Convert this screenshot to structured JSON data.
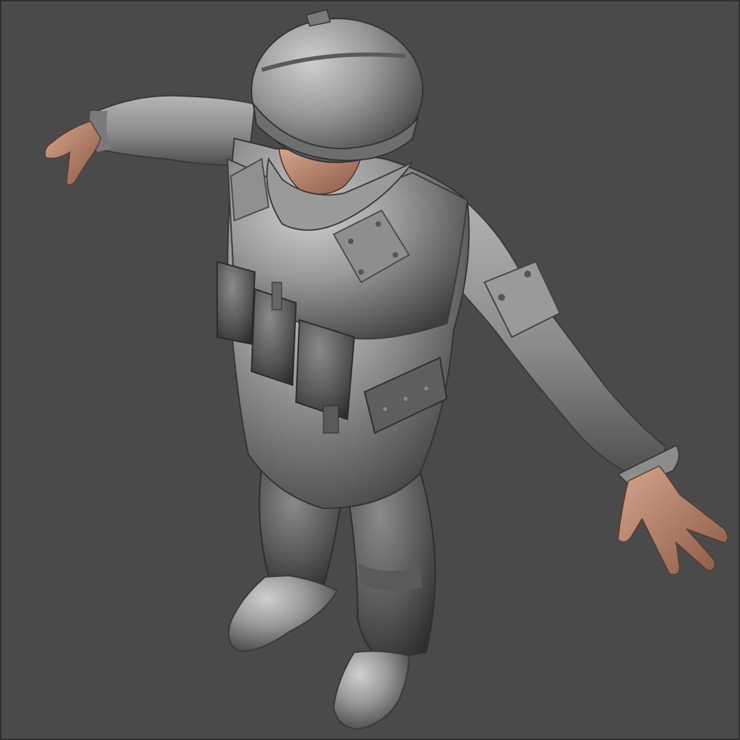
{
  "viewport": {
    "background_color": "#4a4a4a",
    "border_color": "#2e2e2e"
  },
  "model": {
    "subject": "soldier-sculpt",
    "pose": "T-pose",
    "material_color": "#8e8e8e",
    "shadow_color": "#3c3c3c",
    "highlight_color": "#c4c4c4",
    "skin_color": "#b88770"
  }
}
